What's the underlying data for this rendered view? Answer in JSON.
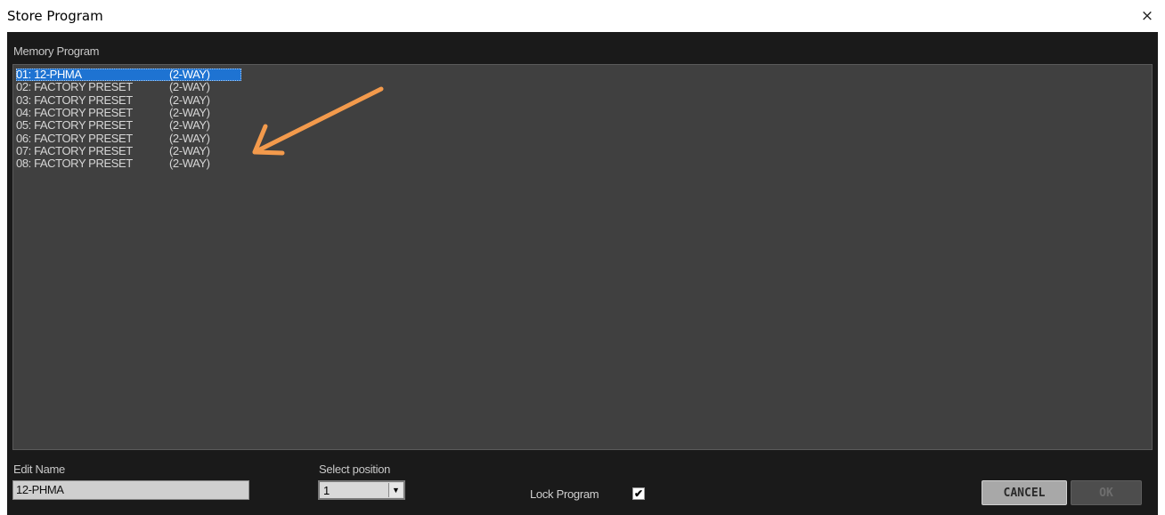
{
  "window": {
    "title": "Store Program",
    "close_glyph": "×"
  },
  "memory_program": {
    "label": "Memory Program",
    "items": [
      {
        "num": "01: 12-PHMA",
        "type": "(2-WAY)",
        "selected": true
      },
      {
        "num": "02: FACTORY PRESET",
        "type": "(2-WAY)",
        "selected": false
      },
      {
        "num": "03: FACTORY PRESET",
        "type": "(2-WAY)",
        "selected": false
      },
      {
        "num": "04: FACTORY PRESET",
        "type": "(2-WAY)",
        "selected": false
      },
      {
        "num": "05: FACTORY PRESET",
        "type": "(2-WAY)",
        "selected": false
      },
      {
        "num": "06: FACTORY PRESET",
        "type": "(2-WAY)",
        "selected": false
      },
      {
        "num": "07: FACTORY PRESET",
        "type": "(2-WAY)",
        "selected": false
      },
      {
        "num": "08: FACTORY PRESET",
        "type": "(2-WAY)",
        "selected": false
      }
    ]
  },
  "edit_name": {
    "label": "Edit Name",
    "value": "12-PHMA"
  },
  "select_position": {
    "label": "Select position",
    "value": "1"
  },
  "lock_program": {
    "label": "Lock Program",
    "checked": true,
    "check_glyph": "✔"
  },
  "buttons": {
    "cancel_label": "CANCEL",
    "ok_label": "OK"
  },
  "colors": {
    "dialog_bg": "#1a1a1a",
    "list_bg": "#404040",
    "selection": "#1e73d2",
    "annotation_arrow": "#f39a4c"
  },
  "icons": {
    "close": "close-icon",
    "dropdown": "chevron-down-icon",
    "checkbox": "checkmark-icon",
    "annotation": "arrow-icon"
  }
}
